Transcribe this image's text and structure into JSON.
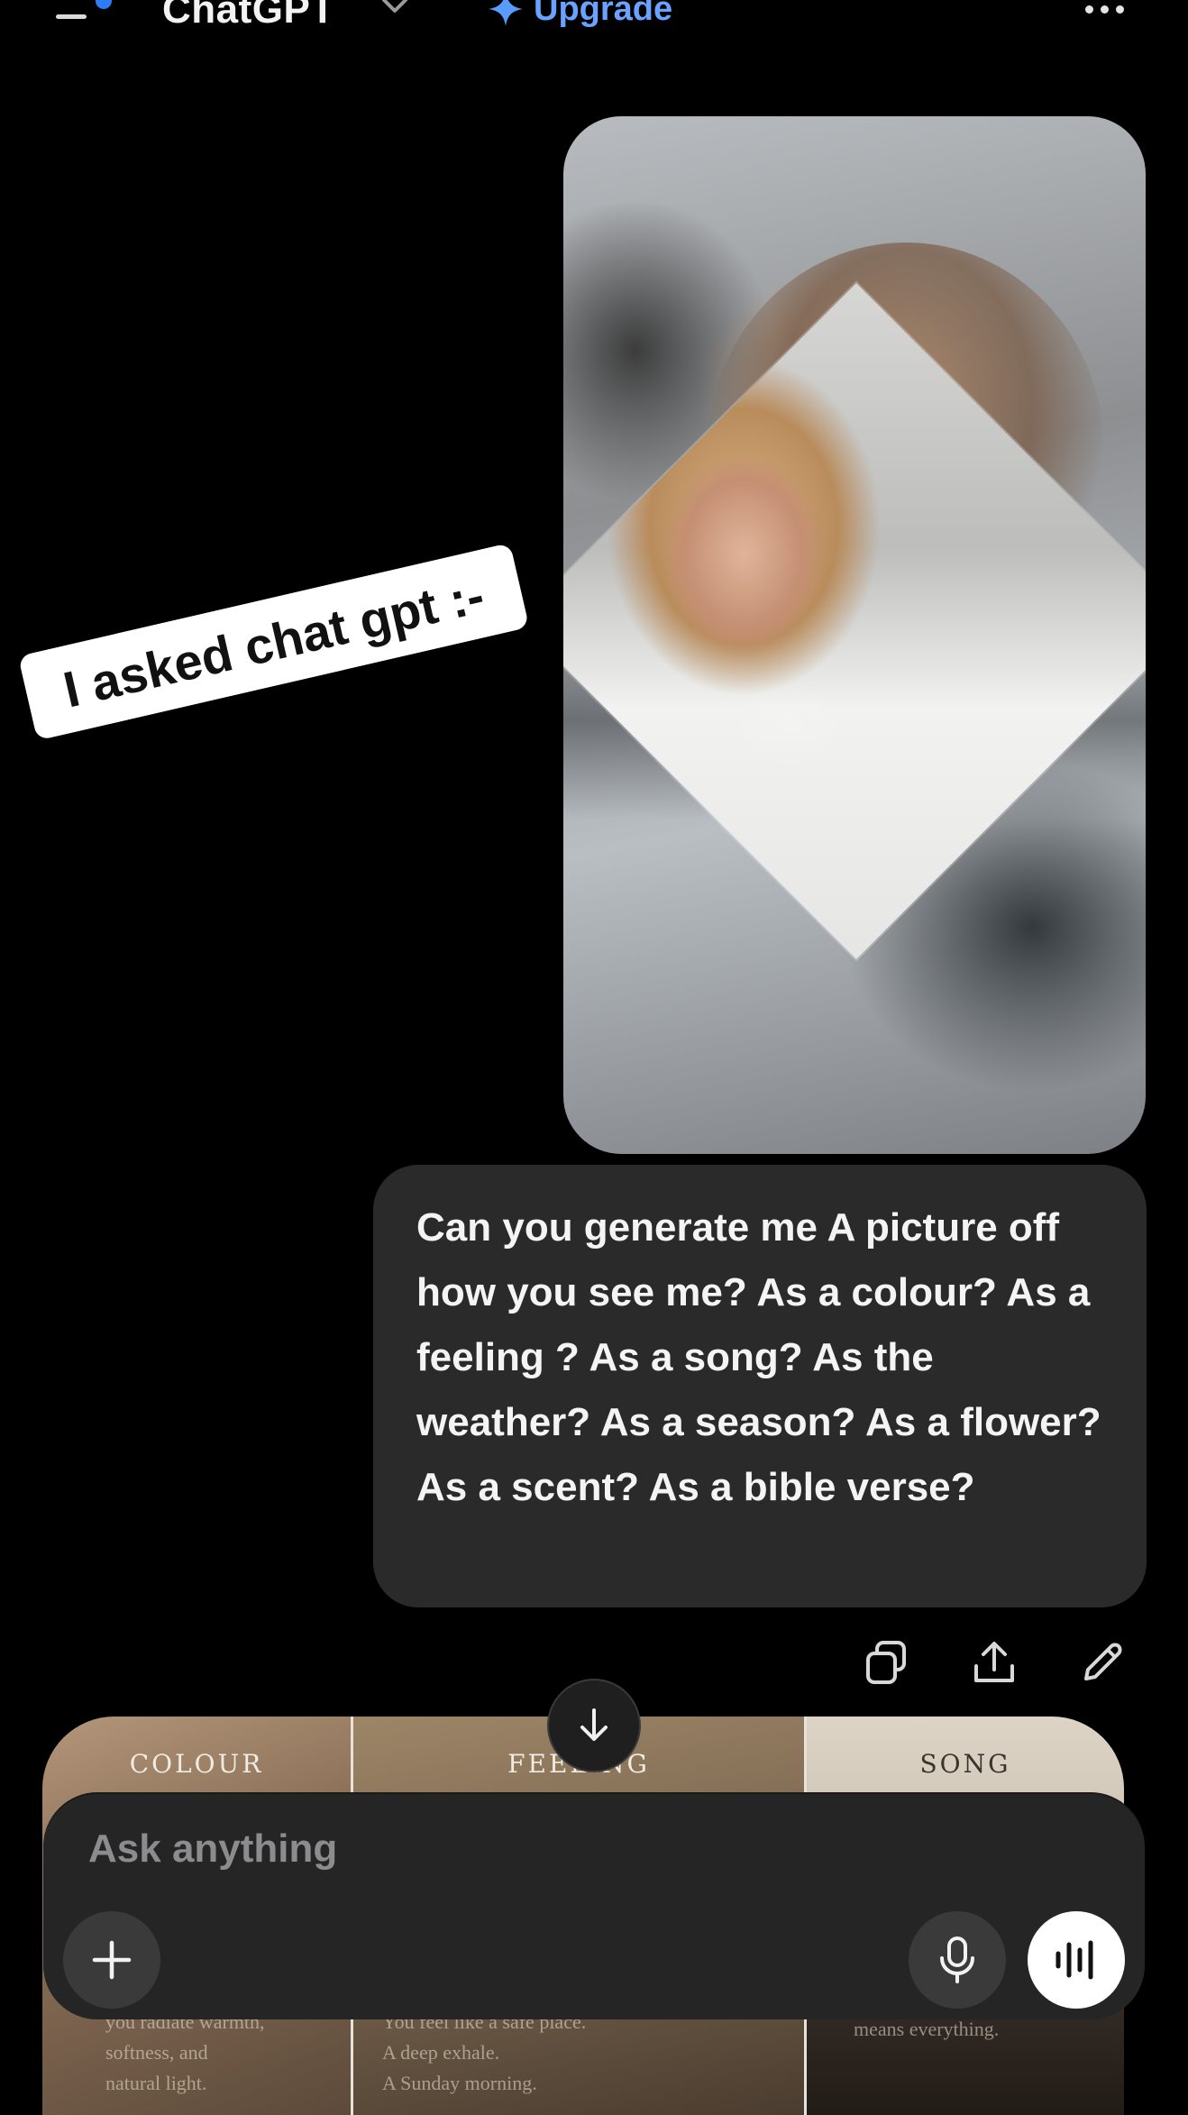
{
  "header": {
    "app_title": "ChatGPT",
    "upgrade_label": "Upgrade",
    "icons": [
      "menu-icon",
      "chevron-down-icon",
      "sparkle-icon",
      "more-icon"
    ]
  },
  "sticker_text": "I asked chat gpt :-",
  "user_message": {
    "text": "Can you generate me A picture off how you see me? As a colour? As a feeling ? As a song? As the weather? As a season? As a flower? As a scent? As a bible verse?",
    "actions": [
      "copy-icon",
      "share-icon",
      "edit-icon"
    ]
  },
  "response_image": {
    "panels": [
      {
        "label": "COLOUR",
        "snippet": "you radiate warmth,\nsoftness, and\nnatural light."
      },
      {
        "label": "FEELING",
        "snippet": "You feel like a safe place.\nA deep exhale.\nA Sunday morning."
      },
      {
        "label": "SONG",
        "snippet": "means everything."
      }
    ]
  },
  "composer": {
    "placeholder": "Ask anything",
    "icons": [
      "plus-icon",
      "microphone-icon",
      "voice-mode-icon",
      "arrow-down-icon"
    ]
  },
  "colors": {
    "background": "#000000",
    "bubble": "#2a2a2b",
    "composer": "#252526",
    "accent": "#6aa2ff"
  }
}
